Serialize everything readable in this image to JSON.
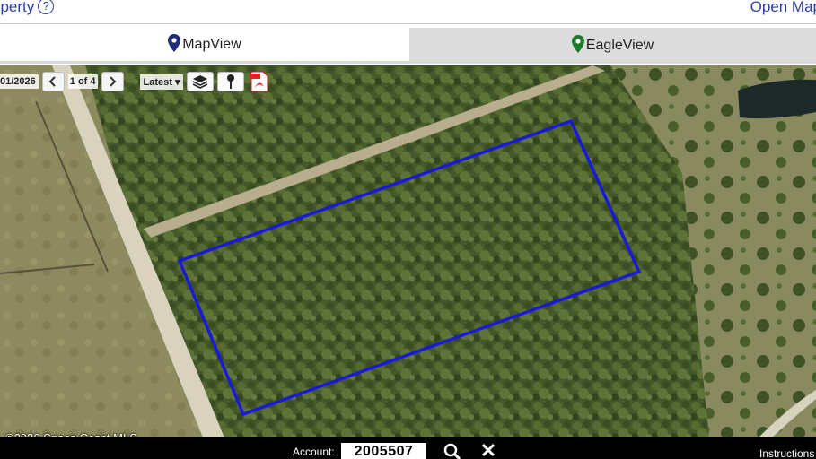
{
  "header": {
    "property_link": "operty",
    "help_glyph": "?",
    "open_map_link": "Open Map"
  },
  "tabs": [
    {
      "label": "MapView",
      "icon": "map-pin-icon",
      "color": "#1f2c7a"
    },
    {
      "label": "EagleView",
      "icon": "map-pin-icon",
      "color": "#1c7a2c"
    }
  ],
  "toolbar": {
    "date": "01/2026",
    "prev_icon": "chevron-left-icon",
    "page_indicator": "1 of 4",
    "next_icon": "chevron-right-icon",
    "version_select": "Latest",
    "layers_icon": "layers-icon",
    "pin_icon": "pushpin-icon",
    "pdf_icon": "pdf-icon"
  },
  "map": {
    "copyright": "©2026 Space Coast MLS",
    "parcel_outline_color": "#1a1ad6"
  },
  "footer": {
    "account_label": "Account:",
    "account_value": "2005507",
    "search_icon": "search-icon",
    "close_icon": "close-icon",
    "instructions_link": "Instructions"
  }
}
